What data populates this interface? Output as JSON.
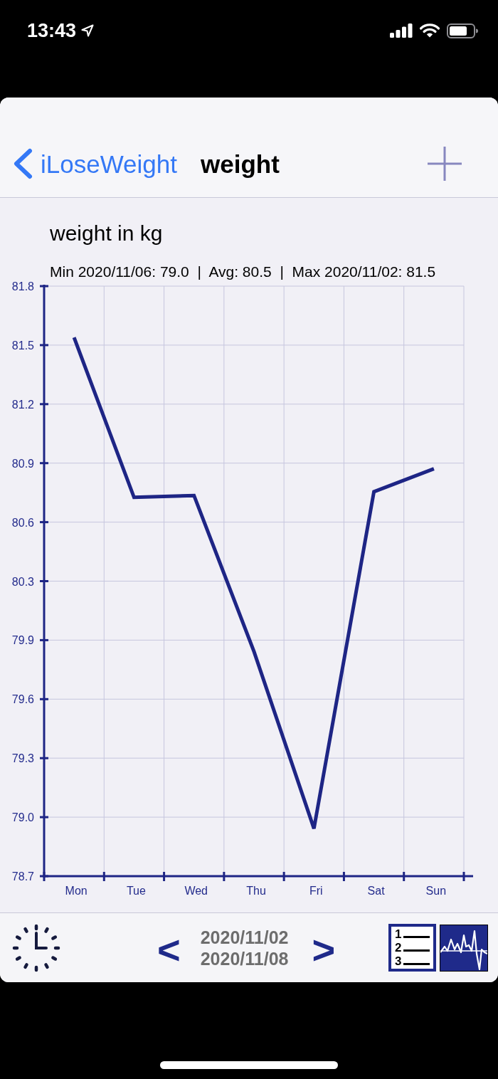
{
  "status_bar": {
    "time": "13:43"
  },
  "nav_bar": {
    "back_label": "iLoseWeight",
    "title": "weight"
  },
  "chart": {
    "stats": "Min 2020/11/06: 79.0  |  Avg: 80.5  |  Max 2020/11/02: 81.5",
    "chart_data": {
      "type": "line",
      "title": "weight in kg",
      "grid": true,
      "categories": [
        "Mon",
        "Tue",
        "Wed",
        "Thu",
        "Fri",
        "Sat",
        "Sun"
      ],
      "series": [
        {
          "color": "#1e2585",
          "values": [
            81.53,
            80.69,
            80.7,
            79.88,
            78.95,
            80.72,
            80.84
          ]
        }
      ],
      "ylim": [
        78.7,
        81.8
      ],
      "yticks": [
        {
          "value": 78.7,
          "label": "78.7"
        },
        {
          "value": 79.01,
          "label": "79.0"
        },
        {
          "value": 79.32,
          "label": "79.3"
        },
        {
          "value": 79.63,
          "label": "79.6"
        },
        {
          "value": 79.94,
          "label": "79.9"
        },
        {
          "value": 80.25,
          "label": "80.3"
        },
        {
          "value": 80.56,
          "label": "80.6"
        },
        {
          "value": 80.87,
          "label": "80.9"
        },
        {
          "value": 81.18,
          "label": "81.2"
        },
        {
          "value": 81.49,
          "label": "81.5"
        },
        {
          "value": 81.8,
          "label": "81.8"
        }
      ]
    }
  },
  "toolbar": {
    "prev": "<",
    "date_range": [
      "2020/11/02",
      "2020/11/08"
    ],
    "next": ">",
    "list_button": {
      "numbers": [
        "1",
        "2",
        "3"
      ]
    }
  }
}
